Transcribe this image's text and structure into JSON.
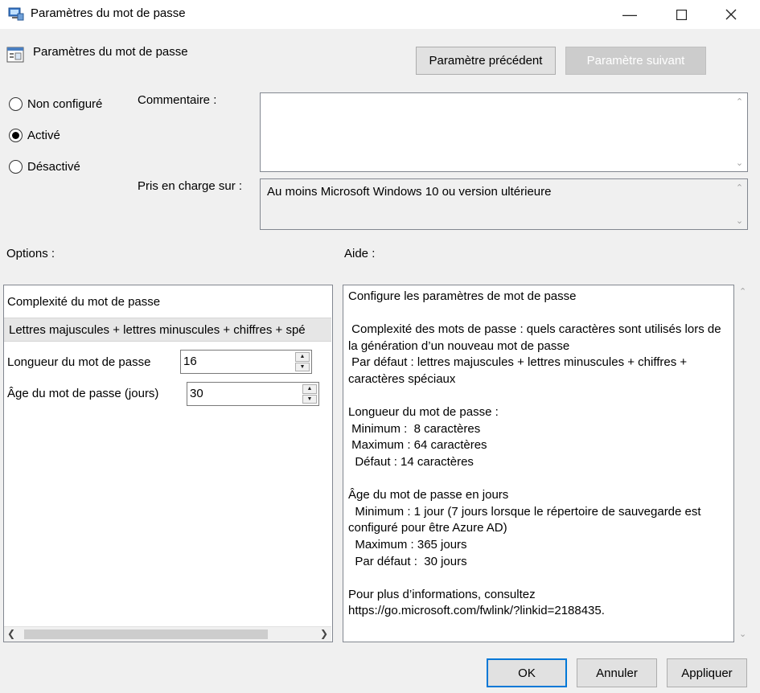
{
  "window": {
    "title": "Paramètres du mot de passe"
  },
  "header": {
    "title": "Paramètres du mot de passe",
    "prev_button": "Paramètre précédent",
    "next_button": "Paramètre suivant"
  },
  "state": {
    "options": [
      "Non configuré",
      "Activé",
      "Désactivé"
    ],
    "selected": "Activé"
  },
  "comment": {
    "label": "Commentaire :",
    "value": ""
  },
  "supported": {
    "label": "Pris en charge sur :",
    "value": "Au moins Microsoft Windows 10 ou version ultérieure"
  },
  "options_section": {
    "label": "Options :",
    "complexity_label": "Complexité du mot de passe",
    "complexity_value": "Lettres majuscules + lettres minuscules + chiffres + spé",
    "length_label": "Longueur du mot de passe",
    "length_value": "16",
    "age_label": "Âge du mot de passe (jours)",
    "age_value": "30"
  },
  "help_section": {
    "label": "Aide :",
    "text": "Configure les paramètres de mot de passe\n\n Complexité des mots de passe : quels caractères sont utilisés lors de la génération d’un nouveau mot de passe\n Par défaut : lettres majuscules + lettres minuscules + chiffres + caractères spéciaux\n\nLongueur du mot de passe :\n Minimum :  8 caractères\n Maximum : 64 caractères\n  Défaut : 14 caractères\n\nÂge du mot de passe en jours\n  Minimum : 1 jour (7 jours lorsque le répertoire de sauvegarde est configuré pour être Azure AD)\n  Maximum : 365 jours\n  Par défaut :  30 jours\n\nPour plus d’informations, consultez\nhttps://go.microsoft.com/fwlink/?linkid=2188435."
  },
  "footer": {
    "ok": "OK",
    "cancel": "Annuler",
    "apply": "Appliquer"
  }
}
